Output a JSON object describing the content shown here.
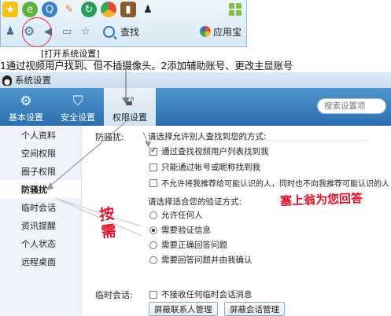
{
  "top_toolbar": {
    "icons_row1": [
      "qzone-icon",
      "browser-icon",
      "search-app-icon",
      "pencil-icon",
      "refresh-icon",
      "chrome-icon",
      "book-icon",
      "qq-penguin-icon"
    ],
    "find_label": "查找",
    "app_store_label": "应用宝"
  },
  "callout": "[打开系统设置]",
  "instruction": "1通过视频用户找到、但不插摄像头。2添加辅助账号、更改主显账号",
  "window": {
    "title": "系统设置",
    "tabs": [
      "基本设置",
      "安全设置",
      "权限设置"
    ],
    "search_placeholder": "搜索设置项",
    "sidebar": [
      "个人资料",
      "空间权限",
      "圈子权限",
      "防骚扰",
      "临时会话",
      "资讯提醒",
      "个人状态",
      "远程桌面"
    ],
    "section_harass": "防骚扰:",
    "q1": "请选择允许别人查找到您的方式:",
    "find_options": [
      {
        "label": "通过查找视频用户列表找到我",
        "checked": true
      },
      {
        "label": "只能通过帐号或昵称找到我",
        "checked": false
      },
      {
        "label": "不允许将我推荐给可能认识的人，同时也不向我推荐可能认识的人",
        "checked": false
      }
    ],
    "q2": "请选择适合您的验证方式:",
    "verify_options": [
      {
        "label": "允许任何人",
        "checked": false
      },
      {
        "label": "需要验证信息",
        "checked": true
      },
      {
        "label": "需要正确回答问题",
        "checked": false
      },
      {
        "label": "需要回答问题并由我确认",
        "checked": false
      }
    ],
    "section_temp": "临时会话:",
    "temp_option": "不接收任何临时会话消息",
    "btn_block_contacts": "屏蔽联系人管理",
    "btn_block_sessions": "屏蔽会话管理"
  },
  "annotations": {
    "answer_note": "塞上翁为您回答",
    "as_needed": "按需"
  },
  "colors": {
    "annotation_red": "#e0102a",
    "nav_blue": "#3a80c0"
  }
}
